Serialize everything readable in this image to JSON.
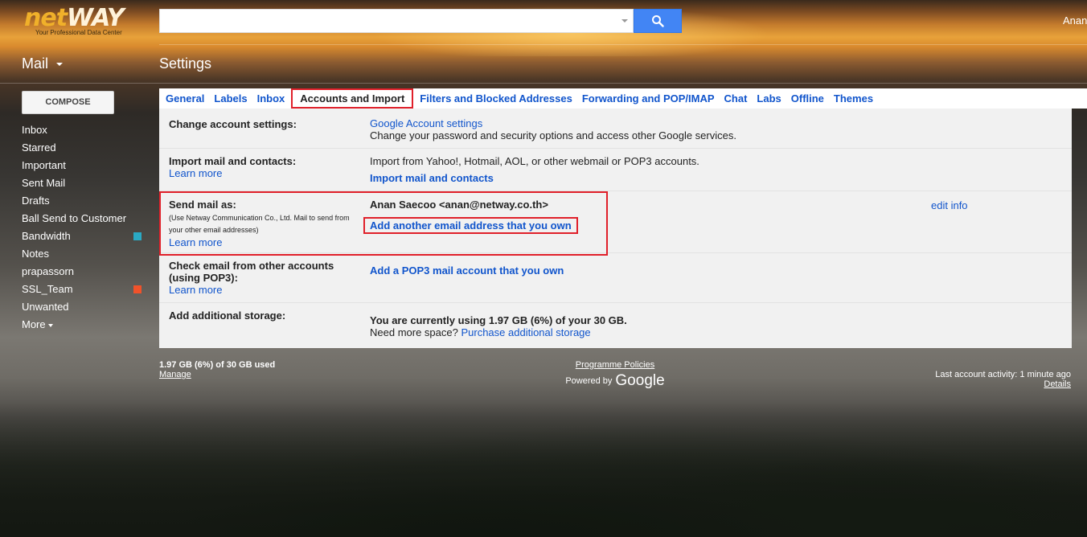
{
  "header": {
    "logo_main": "net",
    "logo_accent": "WAY",
    "logo_tagline": "Your Professional Data Center",
    "search_placeholder": "",
    "search_value": "",
    "user_name": "Anan"
  },
  "app": {
    "mail_label": "Mail",
    "page_title": "Settings"
  },
  "sidebar": {
    "compose_label": "COMPOSE",
    "items": [
      {
        "label": "Inbox"
      },
      {
        "label": "Starred"
      },
      {
        "label": "Important"
      },
      {
        "label": "Sent Mail"
      },
      {
        "label": "Drafts"
      },
      {
        "label": "Ball Send to Customer"
      },
      {
        "label": "Bandwidth",
        "color": "#2aa9c4"
      },
      {
        "label": "Notes"
      },
      {
        "label": "prapassorn"
      },
      {
        "label": "SSL_Team",
        "color": "#f0522a"
      },
      {
        "label": "Unwanted"
      }
    ],
    "more_label": "More"
  },
  "tabs": [
    {
      "label": "General"
    },
    {
      "label": "Labels"
    },
    {
      "label": "Inbox"
    },
    {
      "label": "Accounts and Import",
      "active": true
    },
    {
      "label": "Filters and Blocked Addresses"
    },
    {
      "label": "Forwarding and POP/IMAP"
    },
    {
      "label": "Chat"
    },
    {
      "label": "Labs"
    },
    {
      "label": "Offline"
    },
    {
      "label": "Themes"
    }
  ],
  "settings": {
    "change_account": {
      "label": "Change account settings:",
      "link": "Google Account settings",
      "description": "Change your password and security options and access other Google services."
    },
    "import_mail": {
      "label": "Import mail and contacts:",
      "learn_more": "Learn more",
      "description": "Import from Yahoo!, Hotmail, AOL, or other webmail or POP3 accounts.",
      "action": "Import mail and contacts"
    },
    "send_mail_as": {
      "label": "Send mail as:",
      "note": "(Use Netway Communication Co., Ltd. Mail to send from your other email addresses)",
      "learn_more": "Learn more",
      "identity": "Anan Saecoo <anan@netway.co.th>",
      "add_link": "Add another email address that you own",
      "edit_info": "edit info"
    },
    "check_email": {
      "label": "Check email from other accounts (using POP3):",
      "learn_more": "Learn more",
      "action": "Add a POP3 mail account that you own"
    },
    "storage": {
      "label": "Add additional storage:",
      "usage": "You are currently using 1.97 GB (6%) of your 30 GB.",
      "need_more": "Need more space?",
      "purchase_link": "Purchase additional storage"
    }
  },
  "footer": {
    "usage": "1.97 GB (6%) of 30 GB used",
    "manage": "Manage",
    "policies": "Programme Policies",
    "powered_by": "Powered by",
    "google": "Google",
    "last_activity": "Last account activity: 1 minute ago",
    "details": "Details"
  }
}
